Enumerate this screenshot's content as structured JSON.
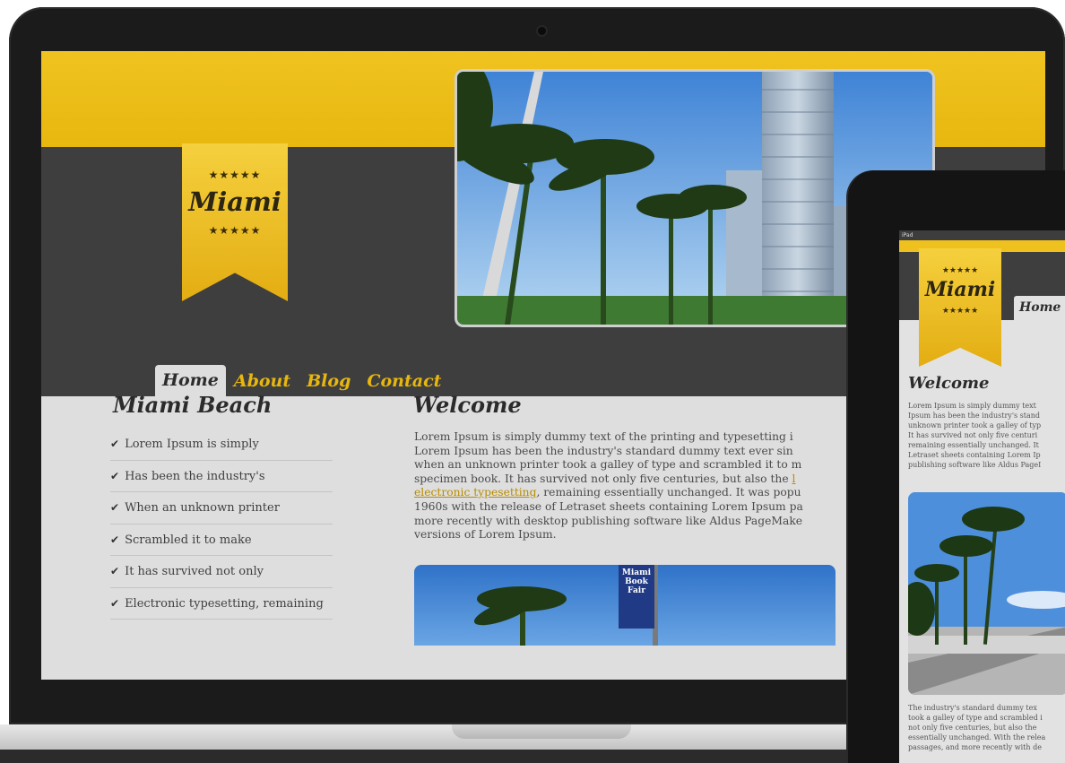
{
  "laptop": {
    "brand": "Miami",
    "stars": "★★★★★",
    "nav": {
      "home": "Home",
      "about": "About",
      "blog": "Blog",
      "contact": "Contact"
    },
    "sidebar": {
      "title": "Miami Beach",
      "check_icon": "✔",
      "items": [
        "Lorem Ipsum is simply",
        "Has been the industry's",
        "When an unknown printer",
        "Scrambled it to make",
        "It has survived not only",
        "Electronic typesetting, remaining"
      ]
    },
    "welcome": {
      "title": "Welcome",
      "lines": [
        "Lorem Ipsum is simply dummy text of the printing and typesetting i",
        "Lorem Ipsum has been the industry's standard dummy text ever sin",
        "when an unknown printer took a galley of type and scrambled it to m",
        "specimen book. It has survived not only five centuries, but also the ",
        "electronic typesetting",
        ", remaining essentially unchanged. It was popu",
        "1960s with the release of Letraset sheets containing Lorem Ipsum pa",
        "more recently with desktop publishing software like Aldus PageMake",
        "versions of Lorem Ipsum."
      ],
      "link_fragment": "l"
    },
    "sign_text": [
      "Miami",
      "Book",
      "Fair"
    ]
  },
  "tablet": {
    "status": "iPad",
    "brand": "Miami",
    "stars": "★★★★★",
    "tab_home": "Home",
    "welcome_title": "Welcome",
    "welcome_lines": [
      "Lorem Ipsum is simply dummy text",
      "Ipsum has been the industry's stand",
      "unknown printer took a galley of typ",
      "It has survived not only five centuri",
      "remaining essentially unchanged. It",
      "Letraset sheets containing Lorem Ip",
      "publishing software like Aldus PageI"
    ],
    "bottom_lines": [
      "The industry's standard dummy tex",
      "took a galley of type and scrambled i",
      "not only five centuries, but also the",
      "essentially unchanged. With the relea",
      "passages, and more recently with de"
    ]
  },
  "colors": {
    "accent_yellow": "#e8b70f",
    "dark_bg": "#3e3e3e",
    "content_bg": "#dedede"
  }
}
